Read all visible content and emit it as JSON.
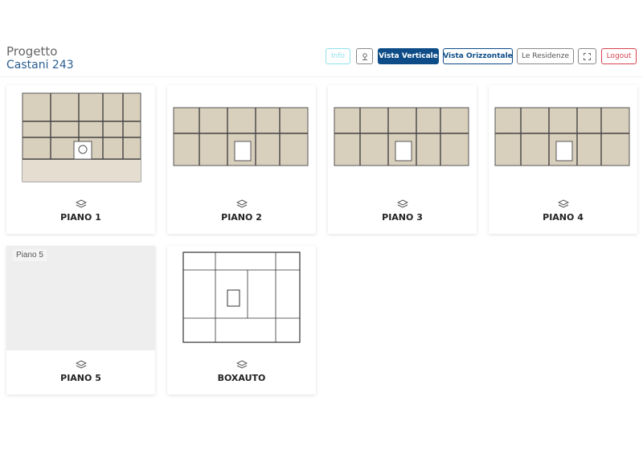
{
  "project": {
    "label": "Progetto",
    "name": "Castani 243"
  },
  "toolbar": {
    "info_label": "Info",
    "vertical_label": "Vista Verticale",
    "horizontal_label": "Vista Orizzontale",
    "residences_label": "Le Residenze",
    "logout_label": "Logout",
    "pin_icon": "location-pin-icon",
    "fullscreen_icon": "fullscreen-icon"
  },
  "colors": {
    "primary": "#0d4c87",
    "info": "#8fe0ea",
    "logout": "#d8404f",
    "plan_fill": "#d9cfbd"
  },
  "floors": [
    {
      "name": "PIANO 1"
    },
    {
      "name": "PIANO 2"
    },
    {
      "name": "PIANO 3"
    },
    {
      "name": "PIANO 4"
    },
    {
      "name": "PIANO 5",
      "placeholder": "Piano 5"
    },
    {
      "name": "BOXAUTO"
    }
  ]
}
